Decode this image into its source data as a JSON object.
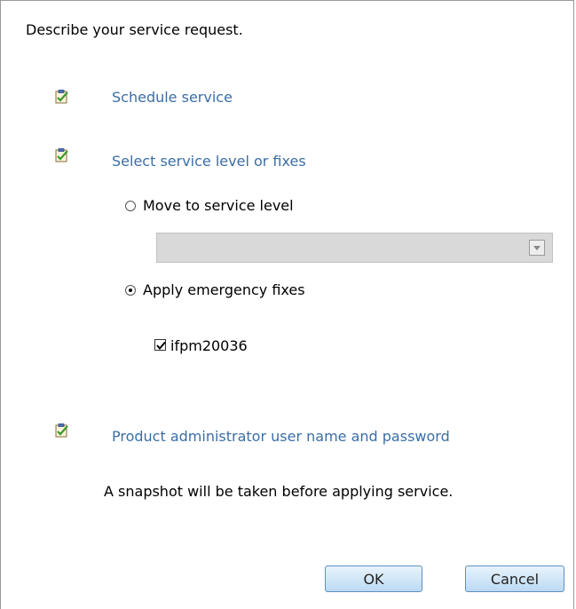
{
  "dialog": {
    "title": "Describe your service request."
  },
  "steps": [
    {
      "label": "Schedule service",
      "icon": "clipboard-check-icon"
    },
    {
      "label": "Select service level or fixes",
      "icon": "clipboard-check-icon"
    },
    {
      "label": "Product administrator user name and password",
      "icon": "clipboard-check-icon"
    }
  ],
  "service_level": {
    "option_move": {
      "label": "Move to service level",
      "selected": false
    },
    "dropdown": {
      "value": ""
    },
    "option_apply": {
      "label": "Apply emergency fixes",
      "selected": true
    },
    "fix": {
      "label": "ifpm20036",
      "checked": true
    }
  },
  "note": "A snapshot will be taken before applying service.",
  "buttons": {
    "ok": "OK",
    "cancel": "Cancel"
  },
  "colors": {
    "link": "#3b6ea5",
    "button_border": "#5f8fc0",
    "check_green": "#3a9a2a"
  }
}
